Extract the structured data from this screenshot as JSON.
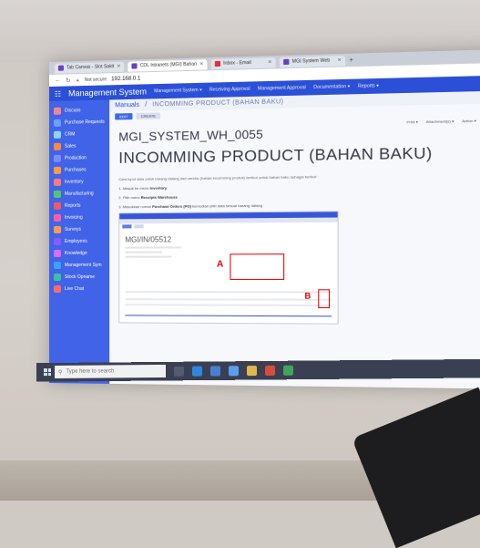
{
  "browser": {
    "tabs": [
      {
        "label": "Tab Canvas - Slot Sakit",
        "active": false
      },
      {
        "label": "CDL Intranets (MGI) Bahan",
        "active": true
      },
      {
        "label": "Inbox - Email",
        "active": false
      },
      {
        "label": "MGI System Web",
        "active": false
      }
    ],
    "security_label": "Not secure",
    "url": "192.168.0.1"
  },
  "app": {
    "brand": "Management System",
    "menus": [
      "Management System ▾",
      "Receiving Approval",
      "Management Approval",
      "Documentation ▾",
      "Reports ▾"
    ]
  },
  "sidebar": {
    "items": [
      {
        "label": "Discuss",
        "color": "#f08a8a"
      },
      {
        "label": "Purchase Requests",
        "color": "#6aa0ff"
      },
      {
        "label": "CRM",
        "color": "#8fd3ff"
      },
      {
        "label": "Sales",
        "color": "#ff8a3d"
      },
      {
        "label": "Production",
        "color": "#7d8cff"
      },
      {
        "label": "Purchases",
        "color": "#ff9b3d"
      },
      {
        "label": "Inventory",
        "color": "#ff7a7a"
      },
      {
        "label": "Manufacturing",
        "color": "#52c86b"
      },
      {
        "label": "Reports",
        "color": "#f35b5b"
      },
      {
        "label": "Invoicing",
        "color": "#ff5fa1"
      },
      {
        "label": "Surveys",
        "color": "#ff9d4a"
      },
      {
        "label": "Employees",
        "color": "#8a5bff"
      },
      {
        "label": "Knowledge",
        "color": "#dd6bff"
      },
      {
        "label": "Management Sym",
        "color": "#3ca0ff"
      },
      {
        "label": "Stock Opname",
        "color": "#3cc0a0"
      },
      {
        "label": "Live Chat",
        "color": "#ff6b6b"
      }
    ]
  },
  "page": {
    "crumb_root": "Manuals",
    "crumb_title": "INCOMMING PRODUCT (BAHAN BAKU)",
    "buttons": {
      "edit": "EDIT",
      "create": "CREATE"
    },
    "actions": [
      "Print ▾",
      "Attachment(s) ▾",
      "Action ▾"
    ],
    "doc_id": "MGI_SYSTEM_WH_0055",
    "doc_title": "INCOMMING PRODUCT (BAHAN BAKU)",
    "intro": "Cara input data untuk barang datang dari vendor (bahan incomming produk) berikut untuk bahan baku sebagai berikut :",
    "steps": [
      {
        "n": "1.",
        "text": "Masuk ke menu ",
        "bold": "Inventory"
      },
      {
        "n": "2.",
        "text": "Pilih menu ",
        "bold": "Receipts Warehouse"
      },
      {
        "n": "3.",
        "text": "Masukkan nomor ",
        "bold": "Purchase Orders (PO)",
        "tail": " kemudian pilih data sesuai barang datang"
      }
    ],
    "embedded": {
      "doc_id": "MGI/IN/05512",
      "mark_a": "A",
      "mark_b": "B"
    }
  },
  "taskbar": {
    "search_placeholder": "Type here to search"
  }
}
